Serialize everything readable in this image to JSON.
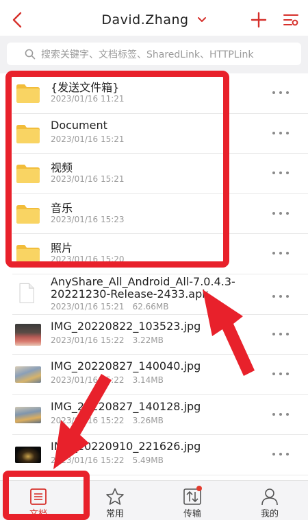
{
  "header": {
    "title": "David.Zhang"
  },
  "search": {
    "placeholder": "搜索关键字、文档标签、SharedLink、HTTPLink"
  },
  "files": [
    {
      "name": "{发送文件箱}",
      "date": "2023/01/16  11:21",
      "size": "",
      "kind": "folder"
    },
    {
      "name": "Document",
      "date": "2023/01/16  15:21",
      "size": "",
      "kind": "folder"
    },
    {
      "name": "视频",
      "date": "2023/01/16  15:21",
      "size": "",
      "kind": "folder"
    },
    {
      "name": "音乐",
      "date": "2023/01/16  15:23",
      "size": "",
      "kind": "folder"
    },
    {
      "name": "照片",
      "date": "2023/01/16  15:20",
      "size": "",
      "kind": "folder"
    },
    {
      "name_line1": "AnyShare_All_Android_All-7.0.4.3-",
      "name_line2": "20221230-Release-2433.apk",
      "date": "2023/01/16  15:21",
      "size": "62.66MB",
      "kind": "file"
    },
    {
      "name": "IMG_20220822_103523.jpg",
      "date": "2023/01/16  15:22",
      "size": "3.22MB",
      "kind": "image"
    },
    {
      "name": "IMG_20220827_140040.jpg",
      "date": "2023/01/16  15:22",
      "size": "3.14MB",
      "kind": "image"
    },
    {
      "name": "IMG_20220827_140128.jpg",
      "date": "2023/01/16  15:22",
      "size": "3.26MB",
      "kind": "image"
    },
    {
      "name": "IMG_20220910_221626.jpg",
      "date": "2023/01/16  15:22",
      "size": "5.49MB",
      "kind": "image"
    }
  ],
  "tabs": [
    {
      "label": "文档",
      "icon": "documents-icon",
      "active": true
    },
    {
      "label": "常用",
      "icon": "star-icon",
      "active": false
    },
    {
      "label": "传输",
      "icon": "transfer-icon",
      "active": false,
      "badge": true
    },
    {
      "label": "我的",
      "icon": "user-icon",
      "active": false
    }
  ],
  "colors": {
    "accent": "#d6302b",
    "folder": "#f7c948",
    "annotation": "#e8212b"
  }
}
